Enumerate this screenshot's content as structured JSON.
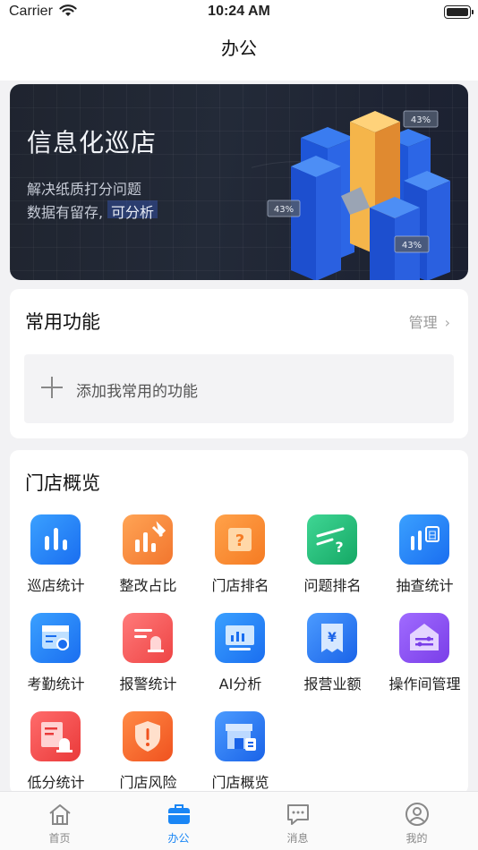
{
  "status_bar": {
    "carrier": "Carrier",
    "time": "10:24 AM"
  },
  "nav": {
    "title": "办公"
  },
  "banner": {
    "title": "信息化巡店",
    "line1": "解决纸质打分问题",
    "line2_prefix": "数据有留存,",
    "line2_highlight": "可分析",
    "badges": [
      "43%",
      "43%",
      "43%"
    ]
  },
  "common": {
    "title": "常用功能",
    "manage": "管理",
    "add_label": "添加我常用的功能"
  },
  "overview": {
    "title": "门店概览",
    "items": [
      {
        "label": "巡店统计",
        "icon": "bar-chart-icon",
        "color": "#1a86f5"
      },
      {
        "label": "整改占比",
        "icon": "tools-chart-icon",
        "color": "#f58a3b"
      },
      {
        "label": "门店排名",
        "icon": "question-box-icon",
        "color": "#f7923a"
      },
      {
        "label": "问题排名",
        "icon": "trend-question-icon",
        "color": "#22c07b"
      },
      {
        "label": "抽查统计",
        "icon": "calendar-chart-icon",
        "color": "#1a86f5"
      },
      {
        "label": "考勤统计",
        "icon": "attendance-calendar-icon",
        "color": "#1a86f5"
      },
      {
        "label": "报警统计",
        "icon": "alarm-icon",
        "color": "#f05454"
      },
      {
        "label": "AI分析",
        "icon": "ai-monitor-icon",
        "color": "#1a86f5"
      },
      {
        "label": "报营业额",
        "icon": "yuan-receipt-icon",
        "color": "#2a7df5"
      },
      {
        "label": "操作间管理",
        "icon": "kitchen-house-icon",
        "color": "#8a4ff0"
      },
      {
        "label": "低分统计",
        "icon": "low-score-bell-icon",
        "color": "#f24b4b"
      },
      {
        "label": "门店风险",
        "icon": "risk-shield-icon",
        "color": "#f36a2e"
      },
      {
        "label": "门店概览",
        "icon": "store-front-icon",
        "color": "#2a7df5"
      }
    ]
  },
  "tabs": [
    {
      "label": "首页",
      "icon": "home-icon"
    },
    {
      "label": "办公",
      "icon": "briefcase-icon",
      "active": true
    },
    {
      "label": "消息",
      "icon": "message-icon"
    },
    {
      "label": "我的",
      "icon": "profile-icon"
    }
  ]
}
